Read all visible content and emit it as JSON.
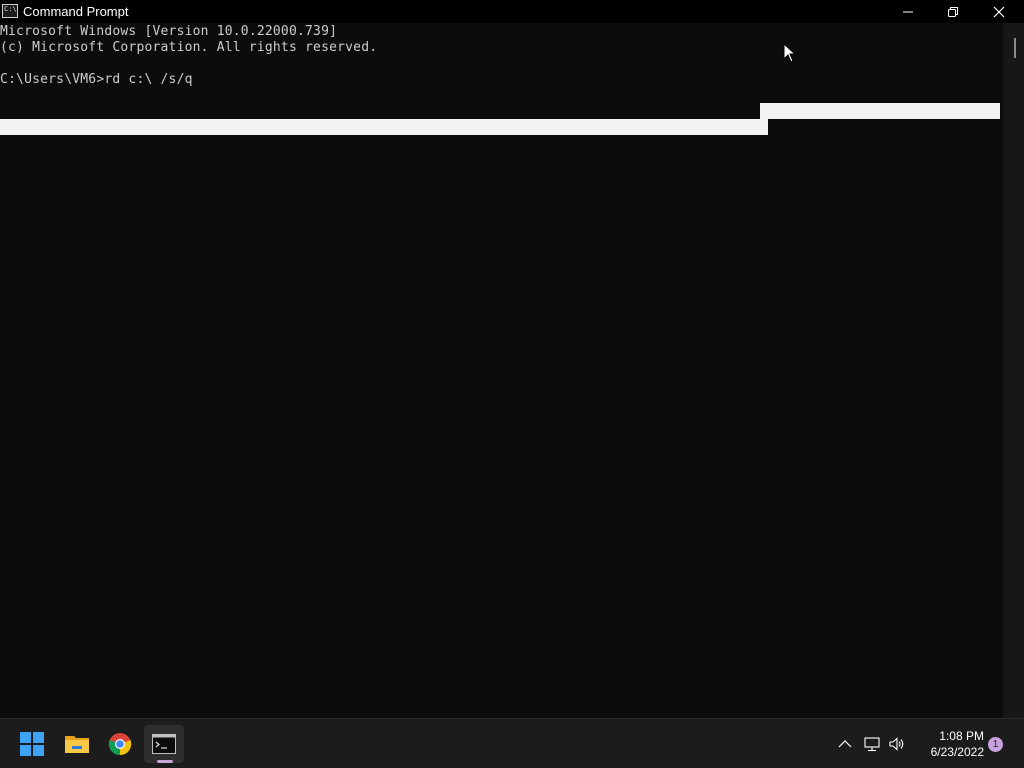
{
  "window": {
    "title": "Command Prompt",
    "buttons": {
      "minimize": "minimize",
      "maximize": "restore",
      "close": "close"
    }
  },
  "console": {
    "lines": [
      "Microsoft Windows [Version 10.0.22000.739]",
      "(c) Microsoft Corporation. All rights reserved.",
      "C:\\Users\\VM6>rd c:\\ /s/q"
    ]
  },
  "taskbar": {
    "apps": [
      {
        "name": "start-icon"
      },
      {
        "name": "file-explorer-icon"
      },
      {
        "name": "chrome-icon"
      },
      {
        "name": "command-prompt-icon"
      }
    ],
    "tray": {
      "time": "1:08 PM",
      "date": "6/23/2022",
      "notification_count": "1"
    }
  },
  "colors": {
    "console_bg": "#0c0c0c",
    "console_text": "#cccccc",
    "titlebar_bg": "#000000",
    "taskbar_bg": "#1c1c1c",
    "badge": "#c8a1df"
  }
}
